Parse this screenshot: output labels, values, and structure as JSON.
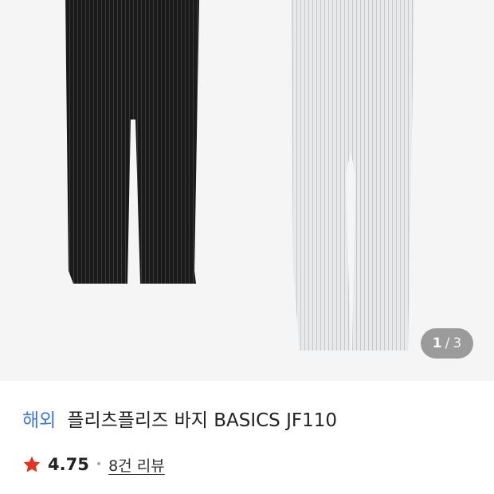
{
  "gallery": {
    "current_page": "1",
    "separator": "/",
    "total_pages": "3",
    "products": [
      {
        "color": "#1a1a1a",
        "pleat": "#3a3a3a"
      },
      {
        "color": "#e6e7e9",
        "pleat": "#c9cacc"
      }
    ]
  },
  "product": {
    "badge": "해외",
    "title": "플리츠플리즈 바지 BASICS JF110"
  },
  "rating": {
    "icon": "star-icon",
    "color": "#e8321f",
    "score": "4.75",
    "separator": "•",
    "reviews_label": "8건 리뷰"
  }
}
